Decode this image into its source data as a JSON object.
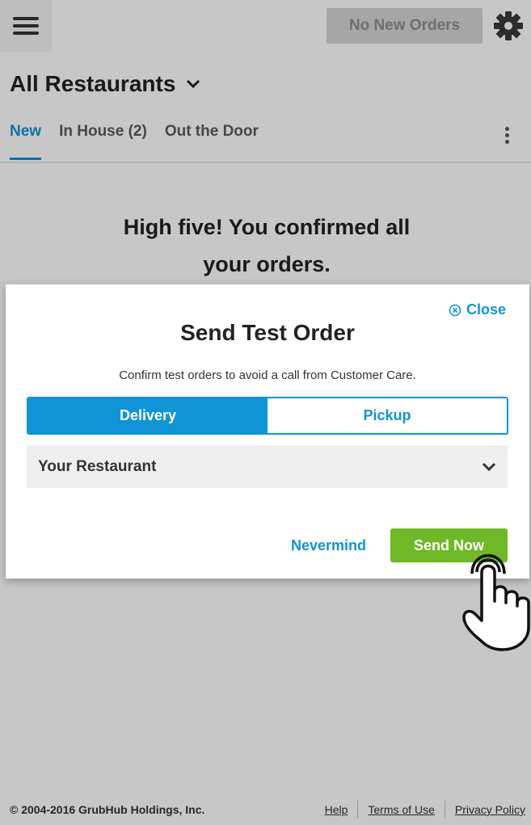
{
  "header": {
    "orders_button": "No New Orders",
    "menu_icon": "hamburger-menu-icon",
    "settings_icon": "gear-icon"
  },
  "page": {
    "title": "All Restaurants",
    "tabs": [
      {
        "label": "New",
        "active": true
      },
      {
        "label": "In House (2)",
        "active": false
      },
      {
        "label": "Out the Door",
        "active": false
      }
    ],
    "hero_line1": "High five! You confirmed all",
    "hero_line2": "your orders."
  },
  "modal": {
    "close_label": "Close",
    "title": "Send Test Order",
    "subtitle": "Confirm test orders to avoid a call from Customer Care.",
    "segments": [
      {
        "label": "Delivery",
        "selected": true
      },
      {
        "label": "Pickup",
        "selected": false
      }
    ],
    "restaurant_select": "Your Restaurant",
    "nevermind_label": "Nevermind",
    "send_label": "Send Now"
  },
  "footer": {
    "copyright": "© 2004-2016 GrubHub Holdings, Inc.",
    "links": [
      "Help",
      "Terms of Use",
      "Privacy Policy"
    ]
  },
  "colors": {
    "accent_blue": "#1193d8",
    "send_green": "#6fb827",
    "disabled_gray": "#d5d5d5"
  }
}
